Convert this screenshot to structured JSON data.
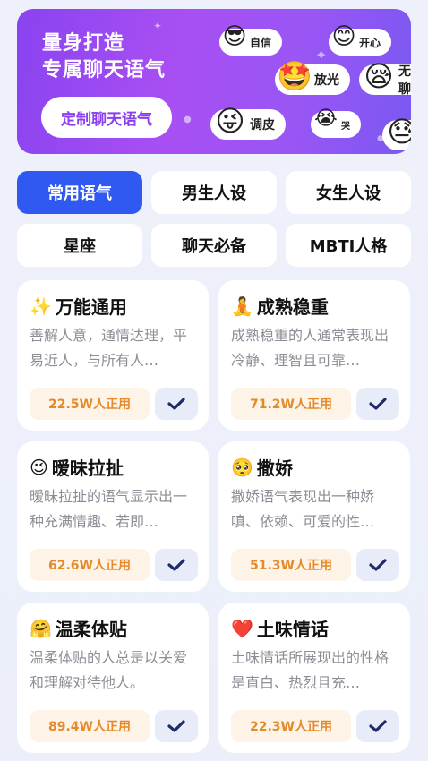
{
  "banner": {
    "title_line1": "量身打造",
    "title_line2": "专属聊天语气",
    "cta_label": "定制聊天语气",
    "chips": [
      {
        "label": "自信",
        "emoji": "😎",
        "icon": "cool-face-icon"
      },
      {
        "label": "开心",
        "emoji": "😊",
        "icon": "smile-face-icon"
      },
      {
        "label": "放光",
        "emoji": "🤩",
        "icon": "star-eyes-face-icon"
      },
      {
        "label": "无聊",
        "emoji": "😪",
        "icon": "sleepy-face-icon"
      },
      {
        "label": "调皮",
        "emoji": "😜",
        "icon": "playful-face-icon"
      },
      {
        "label": "哭",
        "emoji": "😭",
        "icon": "crying-face-icon"
      },
      {
        "label": "",
        "emoji": "😓",
        "icon": "sweat-face-icon"
      }
    ]
  },
  "tabs": [
    {
      "label": "常用语气",
      "active": true
    },
    {
      "label": "男生人设",
      "active": false
    },
    {
      "label": "女生人设",
      "active": false
    },
    {
      "label": "星座",
      "active": false
    },
    {
      "label": "聊天必备",
      "active": false
    },
    {
      "label": "MBTI人格",
      "active": false
    }
  ],
  "cards": [
    {
      "emoji": "✨",
      "icon": "sparkles-icon",
      "title": "万能通用",
      "desc": "善解人意，通情达理，平易近人，与所有人…",
      "usage": "22.5W人正用"
    },
    {
      "emoji": "🧘",
      "icon": "meditation-icon",
      "title": "成熟稳重",
      "desc": "成熟稳重的人通常表现出冷静、理智且可靠…",
      "usage": "71.2W人正用"
    },
    {
      "emoji": "😉",
      "icon": "wink-face-icon",
      "title": "暧昧拉扯",
      "desc": "暧昧拉扯的语气显示出一种充满情趣、若即…",
      "usage": "62.6W人正用"
    },
    {
      "emoji": "🥺",
      "icon": "pleading-face-icon",
      "title": "撒娇",
      "desc": "撒娇语气表现出一种娇嗔、依赖、可爱的性…",
      "usage": "51.3W人正用"
    },
    {
      "emoji": "🤗",
      "icon": "hugging-face-icon",
      "title": "温柔体贴",
      "desc": "温柔体贴的人总是以关爱和理解对待他人。",
      "usage": "89.4W人正用"
    },
    {
      "emoji": "❤️",
      "icon": "red-heart-icon",
      "title": "土味情话",
      "desc": "土味情话所展现出的性格是直白、热烈且充…",
      "usage": "22.3W人正用"
    }
  ],
  "colors": {
    "accent": "#2f59f0",
    "usage_text": "#e58a2a",
    "check": "#1f2a6b"
  }
}
